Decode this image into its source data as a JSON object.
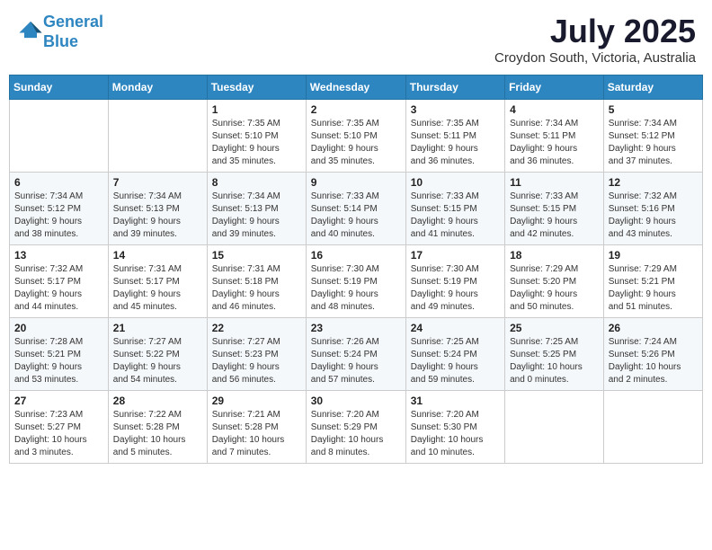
{
  "logo": {
    "line1": "General",
    "line2": "Blue"
  },
  "title": "July 2025",
  "subtitle": "Croydon South, Victoria, Australia",
  "headers": [
    "Sunday",
    "Monday",
    "Tuesday",
    "Wednesday",
    "Thursday",
    "Friday",
    "Saturday"
  ],
  "weeks": [
    [
      {
        "day": "",
        "content": ""
      },
      {
        "day": "",
        "content": ""
      },
      {
        "day": "1",
        "content": "Sunrise: 7:35 AM\nSunset: 5:10 PM\nDaylight: 9 hours\nand 35 minutes."
      },
      {
        "day": "2",
        "content": "Sunrise: 7:35 AM\nSunset: 5:10 PM\nDaylight: 9 hours\nand 35 minutes."
      },
      {
        "day": "3",
        "content": "Sunrise: 7:35 AM\nSunset: 5:11 PM\nDaylight: 9 hours\nand 36 minutes."
      },
      {
        "day": "4",
        "content": "Sunrise: 7:34 AM\nSunset: 5:11 PM\nDaylight: 9 hours\nand 36 minutes."
      },
      {
        "day": "5",
        "content": "Sunrise: 7:34 AM\nSunset: 5:12 PM\nDaylight: 9 hours\nand 37 minutes."
      }
    ],
    [
      {
        "day": "6",
        "content": "Sunrise: 7:34 AM\nSunset: 5:12 PM\nDaylight: 9 hours\nand 38 minutes."
      },
      {
        "day": "7",
        "content": "Sunrise: 7:34 AM\nSunset: 5:13 PM\nDaylight: 9 hours\nand 39 minutes."
      },
      {
        "day": "8",
        "content": "Sunrise: 7:34 AM\nSunset: 5:13 PM\nDaylight: 9 hours\nand 39 minutes."
      },
      {
        "day": "9",
        "content": "Sunrise: 7:33 AM\nSunset: 5:14 PM\nDaylight: 9 hours\nand 40 minutes."
      },
      {
        "day": "10",
        "content": "Sunrise: 7:33 AM\nSunset: 5:15 PM\nDaylight: 9 hours\nand 41 minutes."
      },
      {
        "day": "11",
        "content": "Sunrise: 7:33 AM\nSunset: 5:15 PM\nDaylight: 9 hours\nand 42 minutes."
      },
      {
        "day": "12",
        "content": "Sunrise: 7:32 AM\nSunset: 5:16 PM\nDaylight: 9 hours\nand 43 minutes."
      }
    ],
    [
      {
        "day": "13",
        "content": "Sunrise: 7:32 AM\nSunset: 5:17 PM\nDaylight: 9 hours\nand 44 minutes."
      },
      {
        "day": "14",
        "content": "Sunrise: 7:31 AM\nSunset: 5:17 PM\nDaylight: 9 hours\nand 45 minutes."
      },
      {
        "day": "15",
        "content": "Sunrise: 7:31 AM\nSunset: 5:18 PM\nDaylight: 9 hours\nand 46 minutes."
      },
      {
        "day": "16",
        "content": "Sunrise: 7:30 AM\nSunset: 5:19 PM\nDaylight: 9 hours\nand 48 minutes."
      },
      {
        "day": "17",
        "content": "Sunrise: 7:30 AM\nSunset: 5:19 PM\nDaylight: 9 hours\nand 49 minutes."
      },
      {
        "day": "18",
        "content": "Sunrise: 7:29 AM\nSunset: 5:20 PM\nDaylight: 9 hours\nand 50 minutes."
      },
      {
        "day": "19",
        "content": "Sunrise: 7:29 AM\nSunset: 5:21 PM\nDaylight: 9 hours\nand 51 minutes."
      }
    ],
    [
      {
        "day": "20",
        "content": "Sunrise: 7:28 AM\nSunset: 5:21 PM\nDaylight: 9 hours\nand 53 minutes."
      },
      {
        "day": "21",
        "content": "Sunrise: 7:27 AM\nSunset: 5:22 PM\nDaylight: 9 hours\nand 54 minutes."
      },
      {
        "day": "22",
        "content": "Sunrise: 7:27 AM\nSunset: 5:23 PM\nDaylight: 9 hours\nand 56 minutes."
      },
      {
        "day": "23",
        "content": "Sunrise: 7:26 AM\nSunset: 5:24 PM\nDaylight: 9 hours\nand 57 minutes."
      },
      {
        "day": "24",
        "content": "Sunrise: 7:25 AM\nSunset: 5:24 PM\nDaylight: 9 hours\nand 59 minutes."
      },
      {
        "day": "25",
        "content": "Sunrise: 7:25 AM\nSunset: 5:25 PM\nDaylight: 10 hours\nand 0 minutes."
      },
      {
        "day": "26",
        "content": "Sunrise: 7:24 AM\nSunset: 5:26 PM\nDaylight: 10 hours\nand 2 minutes."
      }
    ],
    [
      {
        "day": "27",
        "content": "Sunrise: 7:23 AM\nSunset: 5:27 PM\nDaylight: 10 hours\nand 3 minutes."
      },
      {
        "day": "28",
        "content": "Sunrise: 7:22 AM\nSunset: 5:28 PM\nDaylight: 10 hours\nand 5 minutes."
      },
      {
        "day": "29",
        "content": "Sunrise: 7:21 AM\nSunset: 5:28 PM\nDaylight: 10 hours\nand 7 minutes."
      },
      {
        "day": "30",
        "content": "Sunrise: 7:20 AM\nSunset: 5:29 PM\nDaylight: 10 hours\nand 8 minutes."
      },
      {
        "day": "31",
        "content": "Sunrise: 7:20 AM\nSunset: 5:30 PM\nDaylight: 10 hours\nand 10 minutes."
      },
      {
        "day": "",
        "content": ""
      },
      {
        "day": "",
        "content": ""
      }
    ]
  ]
}
